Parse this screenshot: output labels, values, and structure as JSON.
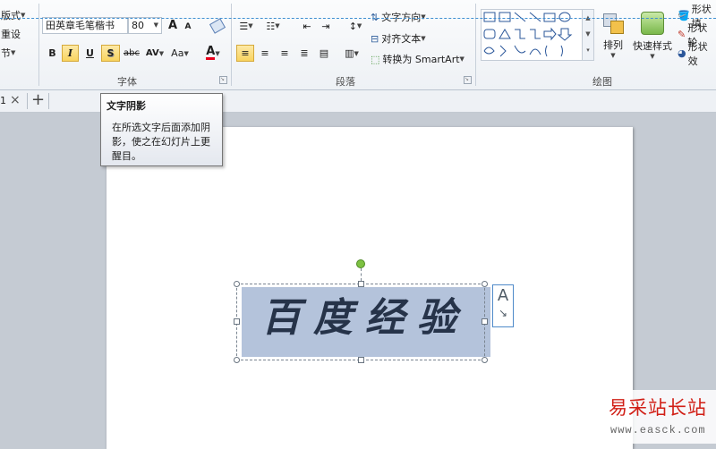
{
  "ribbon": {
    "left_group": {
      "layout": "版式",
      "reset": "重设",
      "section": "节"
    },
    "font": {
      "font_name": "田英章毛笔楷书",
      "font_size": "80",
      "grow": "A",
      "shrink": "A",
      "bold": "B",
      "italic": "I",
      "underline": "U",
      "shadow": "S",
      "strike": "abc",
      "spacing": "AV",
      "case": "Aa",
      "color_a": "A",
      "group_label": "字体"
    },
    "paragraph": {
      "text_direction": "文字方向",
      "align_text": "对齐文本",
      "convert_smartart": "转换为 SmartArt",
      "group_label": "段落"
    },
    "drawing": {
      "arrange": "排列",
      "quick_styles": "快速样式",
      "shape_fill": "形状填",
      "shape_outline": "形状轮",
      "shape_effects": "形状效",
      "group_label": "绘图"
    }
  },
  "tabs": {
    "partial_number": "1",
    "close": "×",
    "add": "+"
  },
  "tooltip": {
    "title": "文字阴影",
    "body": "在所选文字后面添加阴影，使之在幻灯片上更醒目。"
  },
  "slide": {
    "text": "百度经验",
    "textbox_glyph": "A"
  },
  "watermark": {
    "cn": "易采站长站",
    "url": "www.easck.com"
  },
  "colors": {
    "accent_highlight": "#f9d45f",
    "font_color_bar": "#e8001c",
    "rotate_handle": "#7dc142",
    "textbox_fill": "#b4c3db",
    "watermark_red": "#d11f16"
  }
}
